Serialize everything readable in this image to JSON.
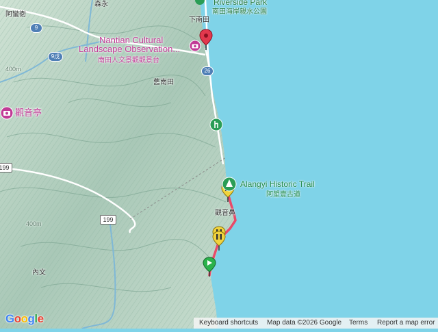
{
  "places": {
    "sensui": "森永",
    "amo": "阿蠻衛",
    "xianantian": "下南田",
    "jiunantian": "舊南田",
    "neiwen": "內文",
    "guanyinbi": "觀音鼻",
    "guanyin_pavilion": "觀音亭"
  },
  "pois": {
    "riverside_park_en": "Riverside Park",
    "riverside_park_zh": "南田海岸親水公園",
    "nantian_en_line1": "Nantian Cultural",
    "nantian_en_line2": "Landscape Observation...",
    "nantian_zh": "南田人文景觀觀景台",
    "alangyi_en": "Alangyi Historic Trail",
    "alangyi_zh": "阿塱壹古道"
  },
  "roads": {
    "r9": "9",
    "r9wu": "9戊",
    "r26": "26",
    "r199": "199",
    "r199_edge": "199"
  },
  "elevations": [
    "400m",
    "400m"
  ],
  "footer": {
    "keyboard": "Keyboard shortcuts",
    "mapdata": "Map data ©2026 Google",
    "terms": "Terms",
    "report": "Report a map error"
  },
  "logo": "Google",
  "colors": {
    "sea": "#7fd3e8",
    "land": "#b7d1c1",
    "track": "#e84a6a",
    "poi": "#c13b96",
    "park": "#2a9d55"
  },
  "icons": {
    "destination_pin": "red-map-pin-icon",
    "start_flag": "green-flag-icon",
    "pause": "yellow-pause-icon",
    "camera": "camera-icon",
    "trail": "hiking-icon"
  }
}
